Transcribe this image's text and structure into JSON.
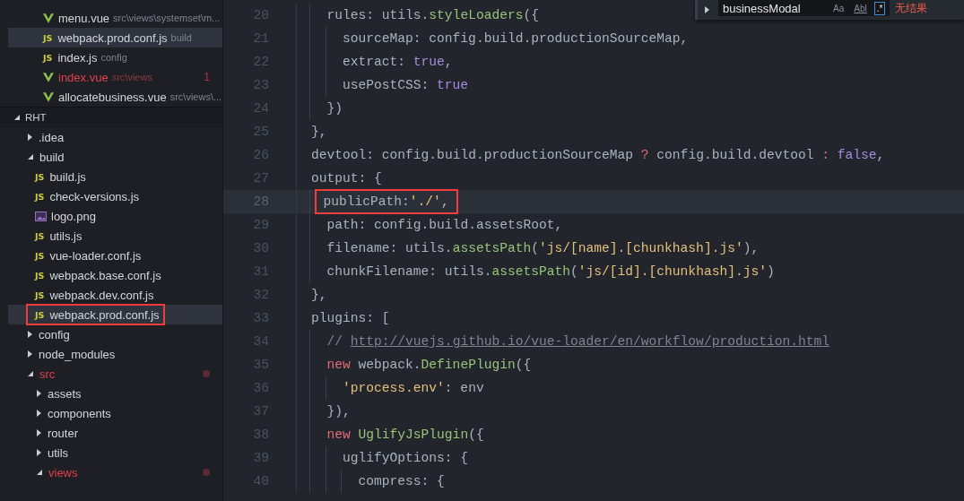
{
  "open_editors": [
    {
      "name": "menu.vue",
      "path": "src\\views\\systemset\\m...",
      "kind": "vue",
      "selected": false,
      "error": false
    },
    {
      "name": "webpack.prod.conf.js",
      "path": "build",
      "kind": "js",
      "badge": "JS",
      "selected": true,
      "error": false
    },
    {
      "name": "index.js",
      "path": "config",
      "kind": "js",
      "badge": "JS",
      "selected": false,
      "error": false
    },
    {
      "name": "index.vue",
      "path": "src\\views",
      "kind": "vue",
      "selected": false,
      "error": true,
      "problems": "1"
    },
    {
      "name": "allocatebusiness.vue",
      "path": "src\\views\\...",
      "kind": "vue",
      "selected": false,
      "error": false
    }
  ],
  "project": {
    "title": "RHT",
    "expanded": true
  },
  "tree": [
    {
      "name": ".idea",
      "kind": "folder",
      "expanded": false,
      "modified": false
    },
    {
      "name": "build",
      "kind": "folder",
      "expanded": true,
      "modified": false,
      "children": [
        {
          "name": "build.js",
          "kind": "js",
          "badge": "JS",
          "selected": false,
          "highlighted": false
        },
        {
          "name": "check-versions.js",
          "kind": "js",
          "badge": "JS",
          "selected": false,
          "highlighted": false
        },
        {
          "name": "logo.png",
          "kind": "image",
          "selected": false,
          "highlighted": false
        },
        {
          "name": "utils.js",
          "kind": "js",
          "badge": "JS",
          "selected": false,
          "highlighted": false
        },
        {
          "name": "vue-loader.conf.js",
          "kind": "js",
          "badge": "JS",
          "selected": false,
          "highlighted": false
        },
        {
          "name": "webpack.base.conf.js",
          "kind": "js",
          "badge": "JS",
          "selected": false,
          "highlighted": false
        },
        {
          "name": "webpack.dev.conf.js",
          "kind": "js",
          "badge": "JS",
          "selected": false,
          "highlighted": false
        },
        {
          "name": "webpack.prod.conf.js",
          "kind": "js",
          "badge": "JS",
          "selected": true,
          "highlighted": true
        }
      ]
    },
    {
      "name": "config",
      "kind": "folder",
      "expanded": false,
      "modified": false
    },
    {
      "name": "node_modules",
      "kind": "folder",
      "expanded": false,
      "modified": false
    },
    {
      "name": "src",
      "kind": "folder",
      "expanded": true,
      "modified": true,
      "children": [
        {
          "name": "assets",
          "kind": "folder",
          "expanded": false,
          "modified": false
        },
        {
          "name": "components",
          "kind": "folder",
          "expanded": false,
          "modified": false
        },
        {
          "name": "router",
          "kind": "folder",
          "expanded": false,
          "modified": false
        },
        {
          "name": "utils",
          "kind": "folder",
          "expanded": false,
          "modified": false
        },
        {
          "name": "views",
          "kind": "folder",
          "expanded": true,
          "modified": true
        }
      ]
    }
  ],
  "find": {
    "value": "businessModal",
    "options": [
      {
        "label": "Aa",
        "selected": false
      },
      {
        "label": "Abl",
        "selected": false
      },
      {
        "label": ".*",
        "selected": true
      }
    ],
    "result": "无结果"
  },
  "code": [
    {
      "number": "20",
      "current": false,
      "highlighted": false,
      "tokens": [
        {
          "text": "  rules: utils.",
          "kind": "plain"
        },
        {
          "text": "styleLoaders",
          "kind": "fn"
        },
        {
          "text": "({",
          "kind": "plain"
        }
      ]
    },
    {
      "number": "21",
      "current": false,
      "highlighted": false,
      "tokens": [
        {
          "text": "    sourceMap: config.build.productionSourceMap,",
          "kind": "plain"
        }
      ]
    },
    {
      "number": "22",
      "current": false,
      "highlighted": false,
      "tokens": [
        {
          "text": "    extract: ",
          "kind": "plain"
        },
        {
          "text": "true",
          "kind": "bool"
        },
        {
          "text": ",",
          "kind": "plain"
        }
      ]
    },
    {
      "number": "23",
      "current": false,
      "highlighted": false,
      "tokens": [
        {
          "text": "    usePostCSS: ",
          "kind": "plain"
        },
        {
          "text": "true",
          "kind": "bool"
        }
      ]
    },
    {
      "number": "24",
      "current": false,
      "highlighted": false,
      "tokens": [
        {
          "text": "  })",
          "kind": "plain"
        }
      ]
    },
    {
      "number": "25",
      "current": false,
      "highlighted": false,
      "tokens": [
        {
          "text": "},",
          "kind": "plain"
        }
      ]
    },
    {
      "number": "26",
      "current": false,
      "highlighted": false,
      "tokens": [
        {
          "text": "devtool: config.build.productionSourceMap ",
          "kind": "plain"
        },
        {
          "text": "?",
          "kind": "op"
        },
        {
          "text": " config.build.devtool ",
          "kind": "plain"
        },
        {
          "text": ": ",
          "kind": "op"
        },
        {
          "text": "false",
          "kind": "bool"
        },
        {
          "text": ",",
          "kind": "plain"
        }
      ]
    },
    {
      "number": "27",
      "current": false,
      "highlighted": false,
      "tokens": [
        {
          "text": "output: {",
          "kind": "plain"
        }
      ]
    },
    {
      "number": "28",
      "current": true,
      "highlighted": true,
      "tokens": [
        {
          "text": "  publicPath:",
          "kind": "plain"
        },
        {
          "text": "'./'",
          "kind": "str"
        },
        {
          "text": ",",
          "kind": "plain"
        }
      ]
    },
    {
      "number": "29",
      "current": false,
      "highlighted": false,
      "tokens": [
        {
          "text": "  path: config.build.assetsRoot,",
          "kind": "plain"
        }
      ]
    },
    {
      "number": "30",
      "current": false,
      "highlighted": false,
      "tokens": [
        {
          "text": "  filename: utils.",
          "kind": "plain"
        },
        {
          "text": "assetsPath",
          "kind": "fn"
        },
        {
          "text": "(",
          "kind": "plain"
        },
        {
          "text": "'js/[name].[chunkhash].js'",
          "kind": "str"
        },
        {
          "text": "),",
          "kind": "plain"
        }
      ]
    },
    {
      "number": "31",
      "current": false,
      "highlighted": false,
      "tokens": [
        {
          "text": "  chunkFilename: utils.",
          "kind": "plain"
        },
        {
          "text": "assetsPath",
          "kind": "fn"
        },
        {
          "text": "(",
          "kind": "plain"
        },
        {
          "text": "'js/[id].[chunkhash].js'",
          "kind": "str"
        },
        {
          "text": ")",
          "kind": "plain"
        }
      ]
    },
    {
      "number": "32",
      "current": false,
      "highlighted": false,
      "tokens": [
        {
          "text": "},",
          "kind": "plain"
        }
      ]
    },
    {
      "number": "33",
      "current": false,
      "highlighted": false,
      "tokens": [
        {
          "text": "plugins: [",
          "kind": "plain"
        }
      ]
    },
    {
      "number": "34",
      "current": false,
      "highlighted": false,
      "tokens": [
        {
          "text": "  // ",
          "kind": "comment"
        },
        {
          "text": "http://vuejs.github.io/vue-loader/en/workflow/production.html",
          "kind": "link"
        }
      ]
    },
    {
      "number": "35",
      "current": false,
      "highlighted": false,
      "tokens": [
        {
          "text": "  new ",
          "kind": "op"
        },
        {
          "text": "webpack.",
          "kind": "plain"
        },
        {
          "text": "DefinePlugin",
          "kind": "fn"
        },
        {
          "text": "({",
          "kind": "plain"
        }
      ]
    },
    {
      "number": "36",
      "current": false,
      "highlighted": false,
      "tokens": [
        {
          "text": "    'process.env'",
          "kind": "str"
        },
        {
          "text": ": env",
          "kind": "plain"
        }
      ]
    },
    {
      "number": "37",
      "current": false,
      "highlighted": false,
      "tokens": [
        {
          "text": "  }),",
          "kind": "plain"
        }
      ]
    },
    {
      "number": "38",
      "current": false,
      "highlighted": false,
      "tokens": [
        {
          "text": "  new ",
          "kind": "op"
        },
        {
          "text": "UglifyJsPlugin",
          "kind": "fn"
        },
        {
          "text": "({",
          "kind": "plain"
        }
      ]
    },
    {
      "number": "39",
      "current": false,
      "highlighted": false,
      "tokens": [
        {
          "text": "    uglifyOptions: {",
          "kind": "plain"
        }
      ]
    },
    {
      "number": "40",
      "current": false,
      "highlighted": false,
      "tokens": [
        {
          "text": "      compress: {",
          "kind": "plain"
        }
      ]
    }
  ]
}
